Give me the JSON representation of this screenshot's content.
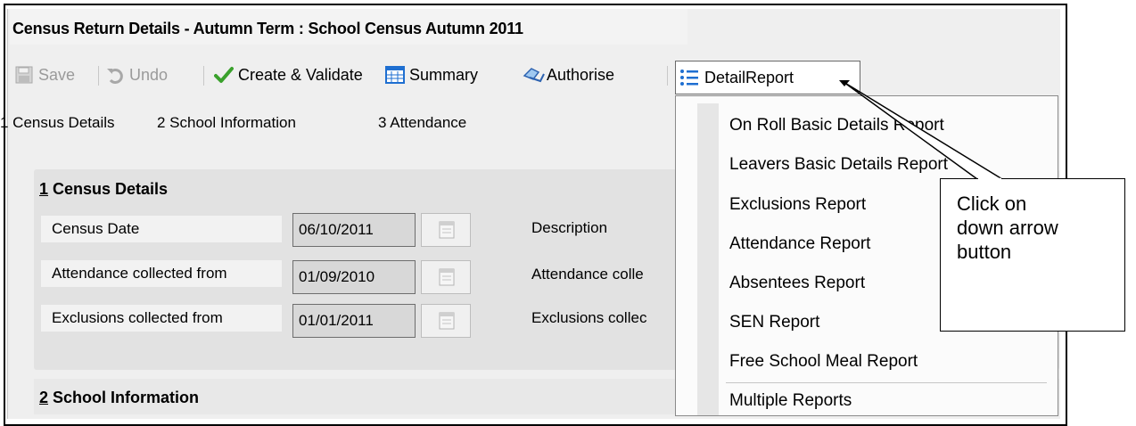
{
  "window": {
    "title": "Census Return Details - Autumn Term : School Census Autumn 2011"
  },
  "toolbar": {
    "save": "Save",
    "undo": "Undo",
    "create_validate": "Create & Validate",
    "summary": "Summary",
    "authorise": "Authorise",
    "detail_report": "DetailReport"
  },
  "nav_links": [
    "1 Census Details",
    "2 School Information",
    "3 Attendance"
  ],
  "section1": {
    "heading_num": "1",
    "heading_text": " Census Details",
    "rows": [
      {
        "label": "Census Date",
        "value": "06/10/2011",
        "right_label": "Description"
      },
      {
        "label": "Attendance collected from",
        "value": "01/09/2010",
        "right_label": "Attendance colle"
      },
      {
        "label": "Exclusions collected from",
        "value": "01/01/2011",
        "right_label": "Exclusions collec"
      }
    ]
  },
  "section2": {
    "heading_num": "2",
    "heading_text": " School Information"
  },
  "menu": {
    "items": [
      "On Roll Basic Details Report",
      "Leavers Basic Details Report",
      "Exclusions Report",
      "Attendance Report",
      "Absentees Report",
      "SEN Report",
      "Free School Meal Report",
      "Multiple Reports"
    ]
  },
  "callout": {
    "line1": "Click on",
    "line2": "down arrow",
    "line3": "button"
  },
  "colors": {
    "accent_blue": "#1f6fd1",
    "check_green": "#3aa12c"
  }
}
